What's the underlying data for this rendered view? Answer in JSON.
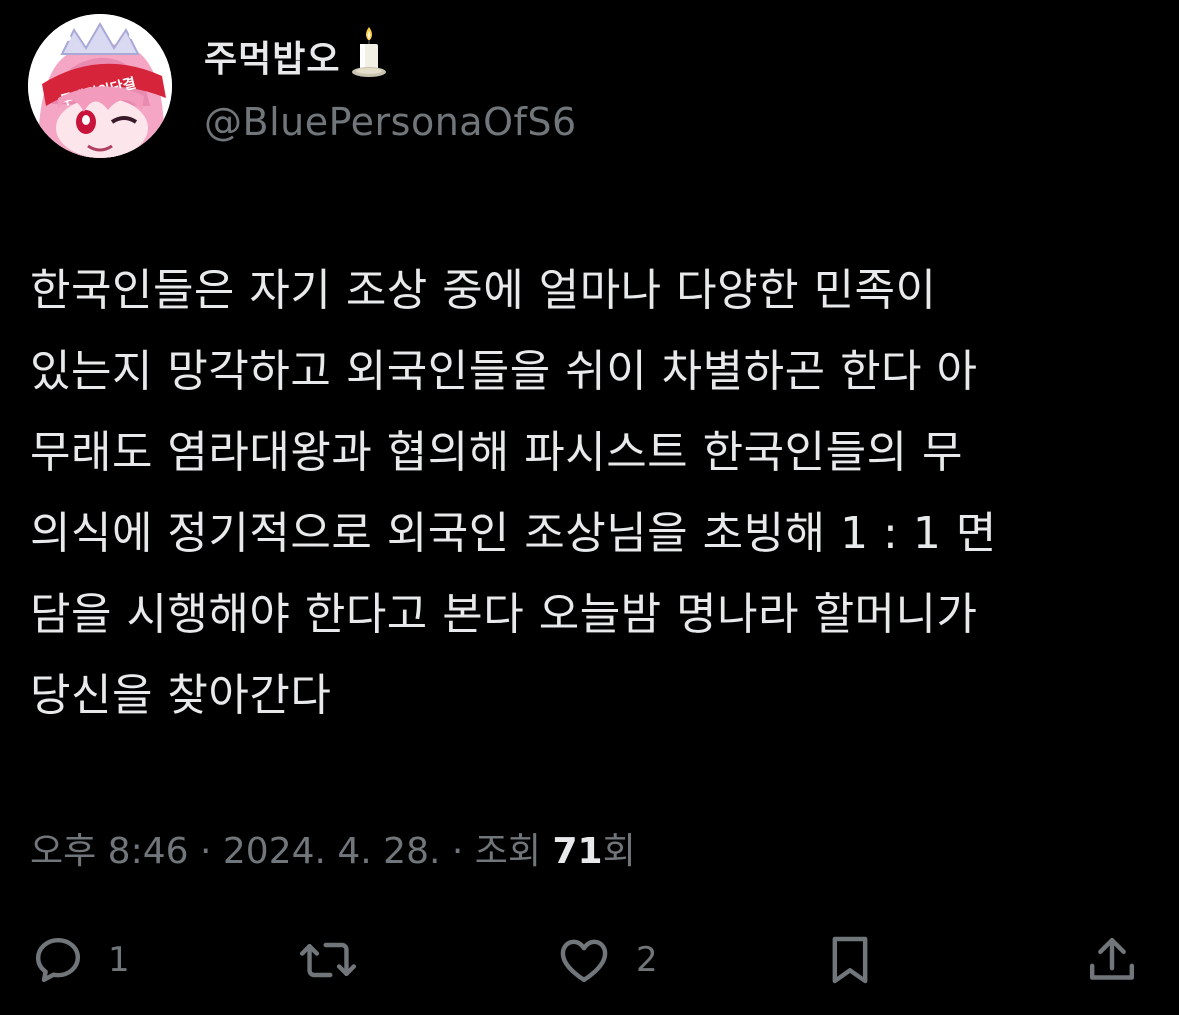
{
  "author": {
    "display_name": "주먹밥오",
    "handle": "@BluePersonaOfS6",
    "avatar_banner_text": "투쟁결의단결"
  },
  "tweet": {
    "lines": [
      "한국인들은 자기 조상 중에 얼마나 다양한 민족이",
      "있는지 망각하고 외국인들을 쉬이 차별하곤 한다 아",
      "무래도 염라대왕과 협의해 파시스트 한국인들의 무",
      "의식에 정기적으로 외국인 조상님을 초빙해 1 : 1 면",
      "담을 시행해야 한다고 본다 오늘밤 명나라 할머니가",
      "당신을 찾아간다"
    ],
    "time": "오후 8:46",
    "separator": "·",
    "date": "2024. 4. 28.",
    "views_label_prefix": "조회",
    "views_count": "71",
    "views_label_suffix": "회"
  },
  "actions": {
    "reply_count": "1",
    "like_count": "2"
  },
  "colors": {
    "background": "#000000",
    "primary_text": "#e7e9ea",
    "secondary_text": "#71767b"
  }
}
